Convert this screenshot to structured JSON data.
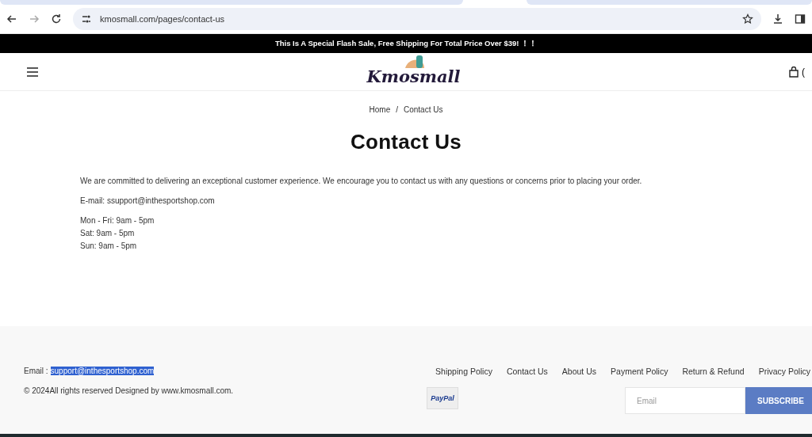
{
  "browser": {
    "url": "kmosmall.com/pages/contact-us"
  },
  "announcement": "This Is A Special Flash Sale, Free Shipping For Total Price Over $39! ！！",
  "header": {
    "logo": "Kmosmall",
    "cart_count": "("
  },
  "breadcrumb": [
    "Home",
    "/",
    "Contact Us"
  ],
  "title": "Contact Us",
  "paragraphs": [
    "We are committed to delivering an exceptional customer experience. We encourage you to contact us with any questions or concerns prior to placing your order.",
    "E-mail: ssupport@inthesportshop.com"
  ],
  "hours": [
    "Mon - Fri: 9am - 5pm",
    "Sat: 9am - 5pm",
    "Sun: 9am - 5pm"
  ],
  "footer": {
    "email_label": "Email :",
    "email": "support@inthesportshop.com",
    "email_selected": true,
    "copyright": "© 2024All rights reserved Designed by www.kmosmall.com.",
    "links": [
      "Shipping Policy",
      "Contact Us",
      "About Us",
      "Payment Policy",
      "Return & Refund",
      "Privacy Policy"
    ],
    "payment": "PayPal",
    "newsletter": {
      "placeholder": "Email",
      "button": "SUBSCRIBE"
    }
  }
}
